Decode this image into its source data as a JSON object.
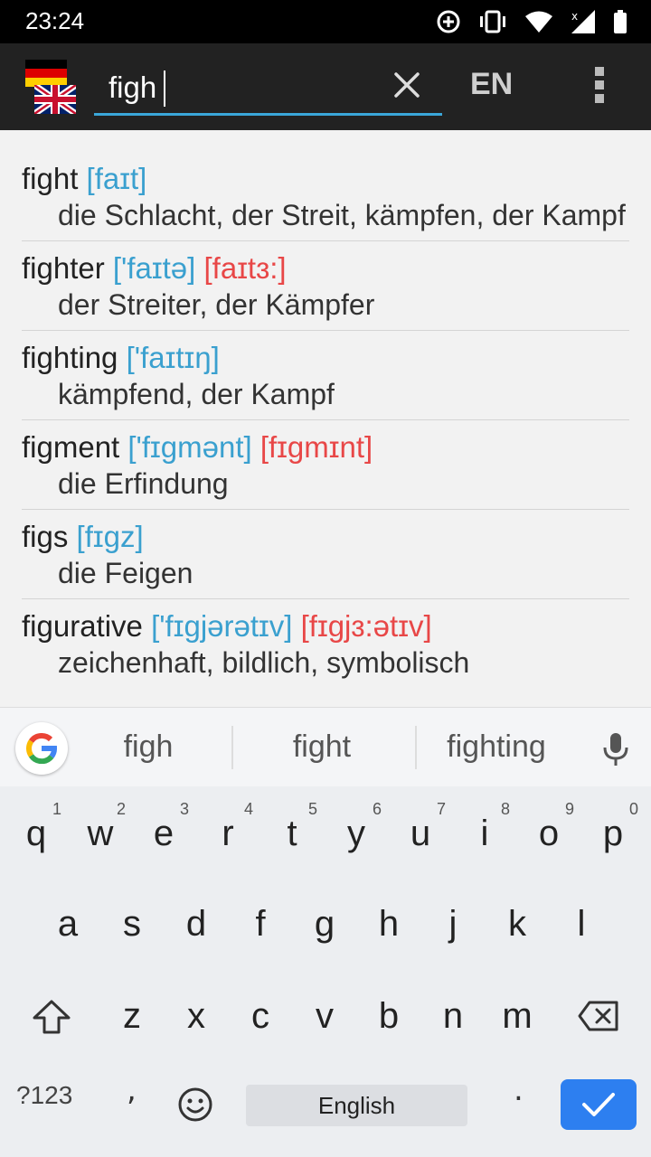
{
  "status_bar": {
    "time": "23:24"
  },
  "app_bar": {
    "search_value": "figh",
    "lang_label": "EN"
  },
  "results": [
    {
      "word": "fight",
      "ipa_uk": "[faɪt]",
      "ipa_us": "",
      "translation": "die Schlacht, der Streit, kämpfen, der Kampf"
    },
    {
      "word": "fighter",
      "ipa_uk": "['faɪtə]",
      "ipa_us": "[faɪtɜ:]",
      "translation": "der Streiter, der Kämpfer"
    },
    {
      "word": "fighting",
      "ipa_uk": "['faɪtɪŋ]",
      "ipa_us": "",
      "translation": "kämpfend, der Kampf"
    },
    {
      "word": "figment",
      "ipa_uk": "['fɪgmənt]",
      "ipa_us": "[fɪgmɪnt]",
      "translation": "die Erfindung"
    },
    {
      "word": "figs",
      "ipa_uk": "[fɪgz]",
      "ipa_us": "",
      "translation": "die Feigen"
    },
    {
      "word": "figurative",
      "ipa_uk": "['fɪgjərətɪv]",
      "ipa_us": "[fɪgjɜ:ətɪv]",
      "translation": "zeichenhaft, bildlich, symbolisch"
    }
  ],
  "suggestions": [
    "figh",
    "fight",
    "fighting"
  ],
  "keyboard": {
    "row1": [
      {
        "k": "q",
        "h": "1"
      },
      {
        "k": "w",
        "h": "2"
      },
      {
        "k": "e",
        "h": "3"
      },
      {
        "k": "r",
        "h": "4"
      },
      {
        "k": "t",
        "h": "5"
      },
      {
        "k": "y",
        "h": "6"
      },
      {
        "k": "u",
        "h": "7"
      },
      {
        "k": "i",
        "h": "8"
      },
      {
        "k": "o",
        "h": "9"
      },
      {
        "k": "p",
        "h": "0"
      }
    ],
    "row2": [
      "a",
      "s",
      "d",
      "f",
      "g",
      "h",
      "j",
      "k",
      "l"
    ],
    "row3": [
      "z",
      "x",
      "c",
      "v",
      "b",
      "n",
      "m"
    ],
    "symbols_label": "?123",
    "comma": ",",
    "space_label": "English",
    "dot": "."
  },
  "colors": {
    "ipa_uk": "#3aa0cf",
    "ipa_us": "#e84747",
    "accent": "#3aa7d9",
    "enter": "#2d7ff0"
  }
}
